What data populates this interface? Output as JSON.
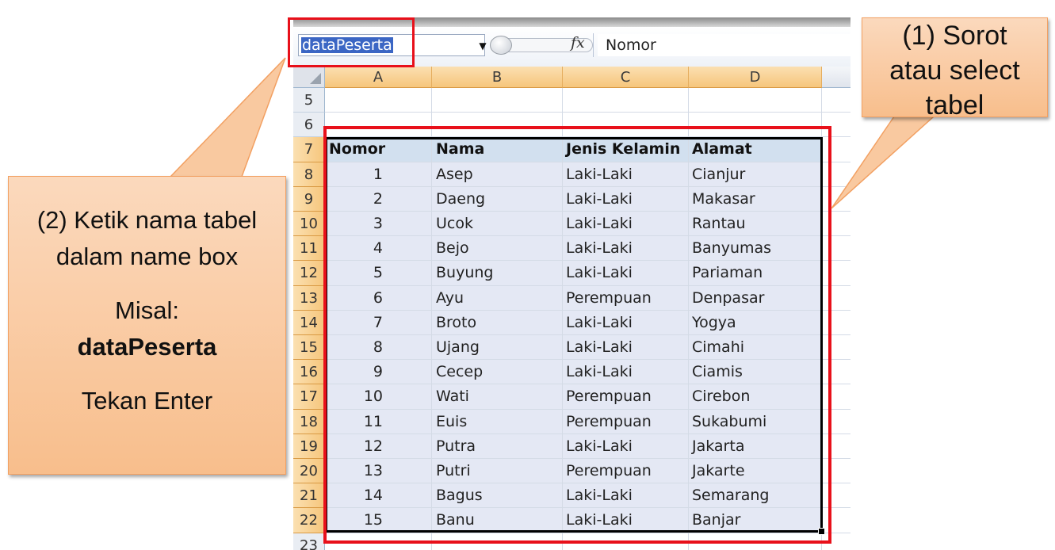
{
  "name_box": {
    "value": "dataPeserta",
    "dropdown_glyph": "▼"
  },
  "formula_bar": {
    "fx_label": "fx",
    "content": "Nomor"
  },
  "columns": [
    "A",
    "B",
    "C",
    "D"
  ],
  "row_numbers": [
    "5",
    "6",
    "7",
    "8",
    "9",
    "10",
    "11",
    "12",
    "13",
    "14",
    "15",
    "16",
    "17",
    "18",
    "19",
    "20",
    "21",
    "22",
    "23"
  ],
  "table": {
    "headers": [
      "Nomor",
      "Nama",
      "Jenis Kelamin",
      "Alamat"
    ],
    "rows": [
      [
        "1",
        "Asep",
        "Laki-Laki",
        "Cianjur"
      ],
      [
        "2",
        "Daeng",
        "Laki-Laki",
        "Makasar"
      ],
      [
        "3",
        "Ucok",
        "Laki-Laki",
        "Rantau"
      ],
      [
        "4",
        "Bejo",
        "Laki-Laki",
        "Banyumas"
      ],
      [
        "5",
        "Buyung",
        "Laki-Laki",
        "Pariaman"
      ],
      [
        "6",
        "Ayu",
        "Perempuan",
        "Denpasar"
      ],
      [
        "7",
        "Broto",
        "Laki-Laki",
        "Yogya"
      ],
      [
        "8",
        "Ujang",
        "Laki-Laki",
        "Cimahi"
      ],
      [
        "9",
        "Cecep",
        "Laki-Laki",
        "Ciamis"
      ],
      [
        "10",
        "Wati",
        "Perempuan",
        "Cirebon"
      ],
      [
        "11",
        "Euis",
        "Perempuan",
        "Sukabumi"
      ],
      [
        "12",
        "Putra",
        "Laki-Laki",
        "Jakarta"
      ],
      [
        "13",
        "Putri",
        "Perempuan",
        "Jakarte"
      ],
      [
        "14",
        "Bagus",
        "Laki-Laki",
        "Semarang"
      ],
      [
        "15",
        "Banu",
        "Laki-Laki",
        "Banjar"
      ]
    ]
  },
  "callout_left": {
    "line1": "(2) Ketik nama tabel",
    "line2": "dalam name box",
    "line3": "Misal:",
    "line4": "dataPeserta",
    "line5": "Tekan Enter"
  },
  "callout_right": {
    "line1": "(1) Sorot",
    "line2": "atau select",
    "line3": "tabel"
  },
  "colors": {
    "highlight": "#e8101a",
    "callout_fill": "#f8be8c",
    "selected_header": "#f6c67c",
    "selection_fill": "#e4e8f4"
  }
}
